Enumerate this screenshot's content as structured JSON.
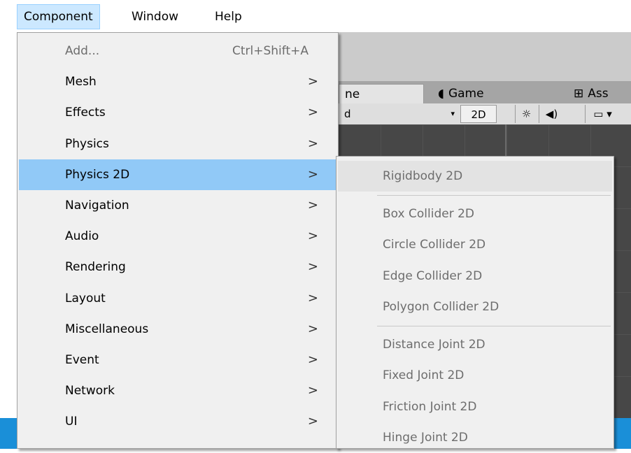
{
  "menubar": {
    "items": [
      {
        "label": "Component",
        "active": true
      },
      {
        "label": "Window",
        "active": false
      },
      {
        "label": "Help",
        "active": false
      }
    ]
  },
  "editor": {
    "tabs": [
      {
        "label": "ne",
        "icon": "scene-icon"
      },
      {
        "label": "Game",
        "icon": "game-pacman-icon",
        "glyph": "◖"
      },
      {
        "label": "Ass",
        "icon": "asset-store-icon",
        "glyph": "⊞"
      }
    ],
    "controls": {
      "scene_mode": "d",
      "mode_2d": "2D",
      "light_glyph": "☼",
      "audio_glyph": "◀)",
      "fx_glyph": "▭ ▾"
    }
  },
  "component_menu": {
    "items": [
      {
        "label": "Add...",
        "shortcut": "Ctrl+Shift+A",
        "submenu": false,
        "disabled": true
      },
      {
        "label": "Mesh",
        "submenu": true
      },
      {
        "label": "Effects",
        "submenu": true
      },
      {
        "label": "Physics",
        "submenu": true
      },
      {
        "label": "Physics 2D",
        "submenu": true,
        "highlight": true
      },
      {
        "label": "Navigation",
        "submenu": true
      },
      {
        "label": "Audio",
        "submenu": true
      },
      {
        "label": "Rendering",
        "submenu": true
      },
      {
        "label": "Layout",
        "submenu": true
      },
      {
        "label": "Miscellaneous",
        "submenu": true
      },
      {
        "label": "Event",
        "submenu": true
      },
      {
        "label": "Network",
        "submenu": true
      },
      {
        "label": "UI",
        "submenu": true
      }
    ],
    "arrow_glyph": ">"
  },
  "physics2d_menu": {
    "groups": [
      [
        "Rigidbody 2D"
      ],
      [
        "Box Collider 2D",
        "Circle Collider 2D",
        "Edge Collider 2D",
        "Polygon Collider 2D"
      ],
      [
        "Distance Joint 2D",
        "Fixed Joint 2D",
        "Friction Joint 2D",
        "Hinge Joint 2D"
      ]
    ]
  },
  "colors": {
    "menu_highlight": "#91c9f7",
    "menubar_active": "#cce8ff",
    "disabled_text": "#6d6d6d",
    "taskbar_blue": "#1a8fd8"
  }
}
